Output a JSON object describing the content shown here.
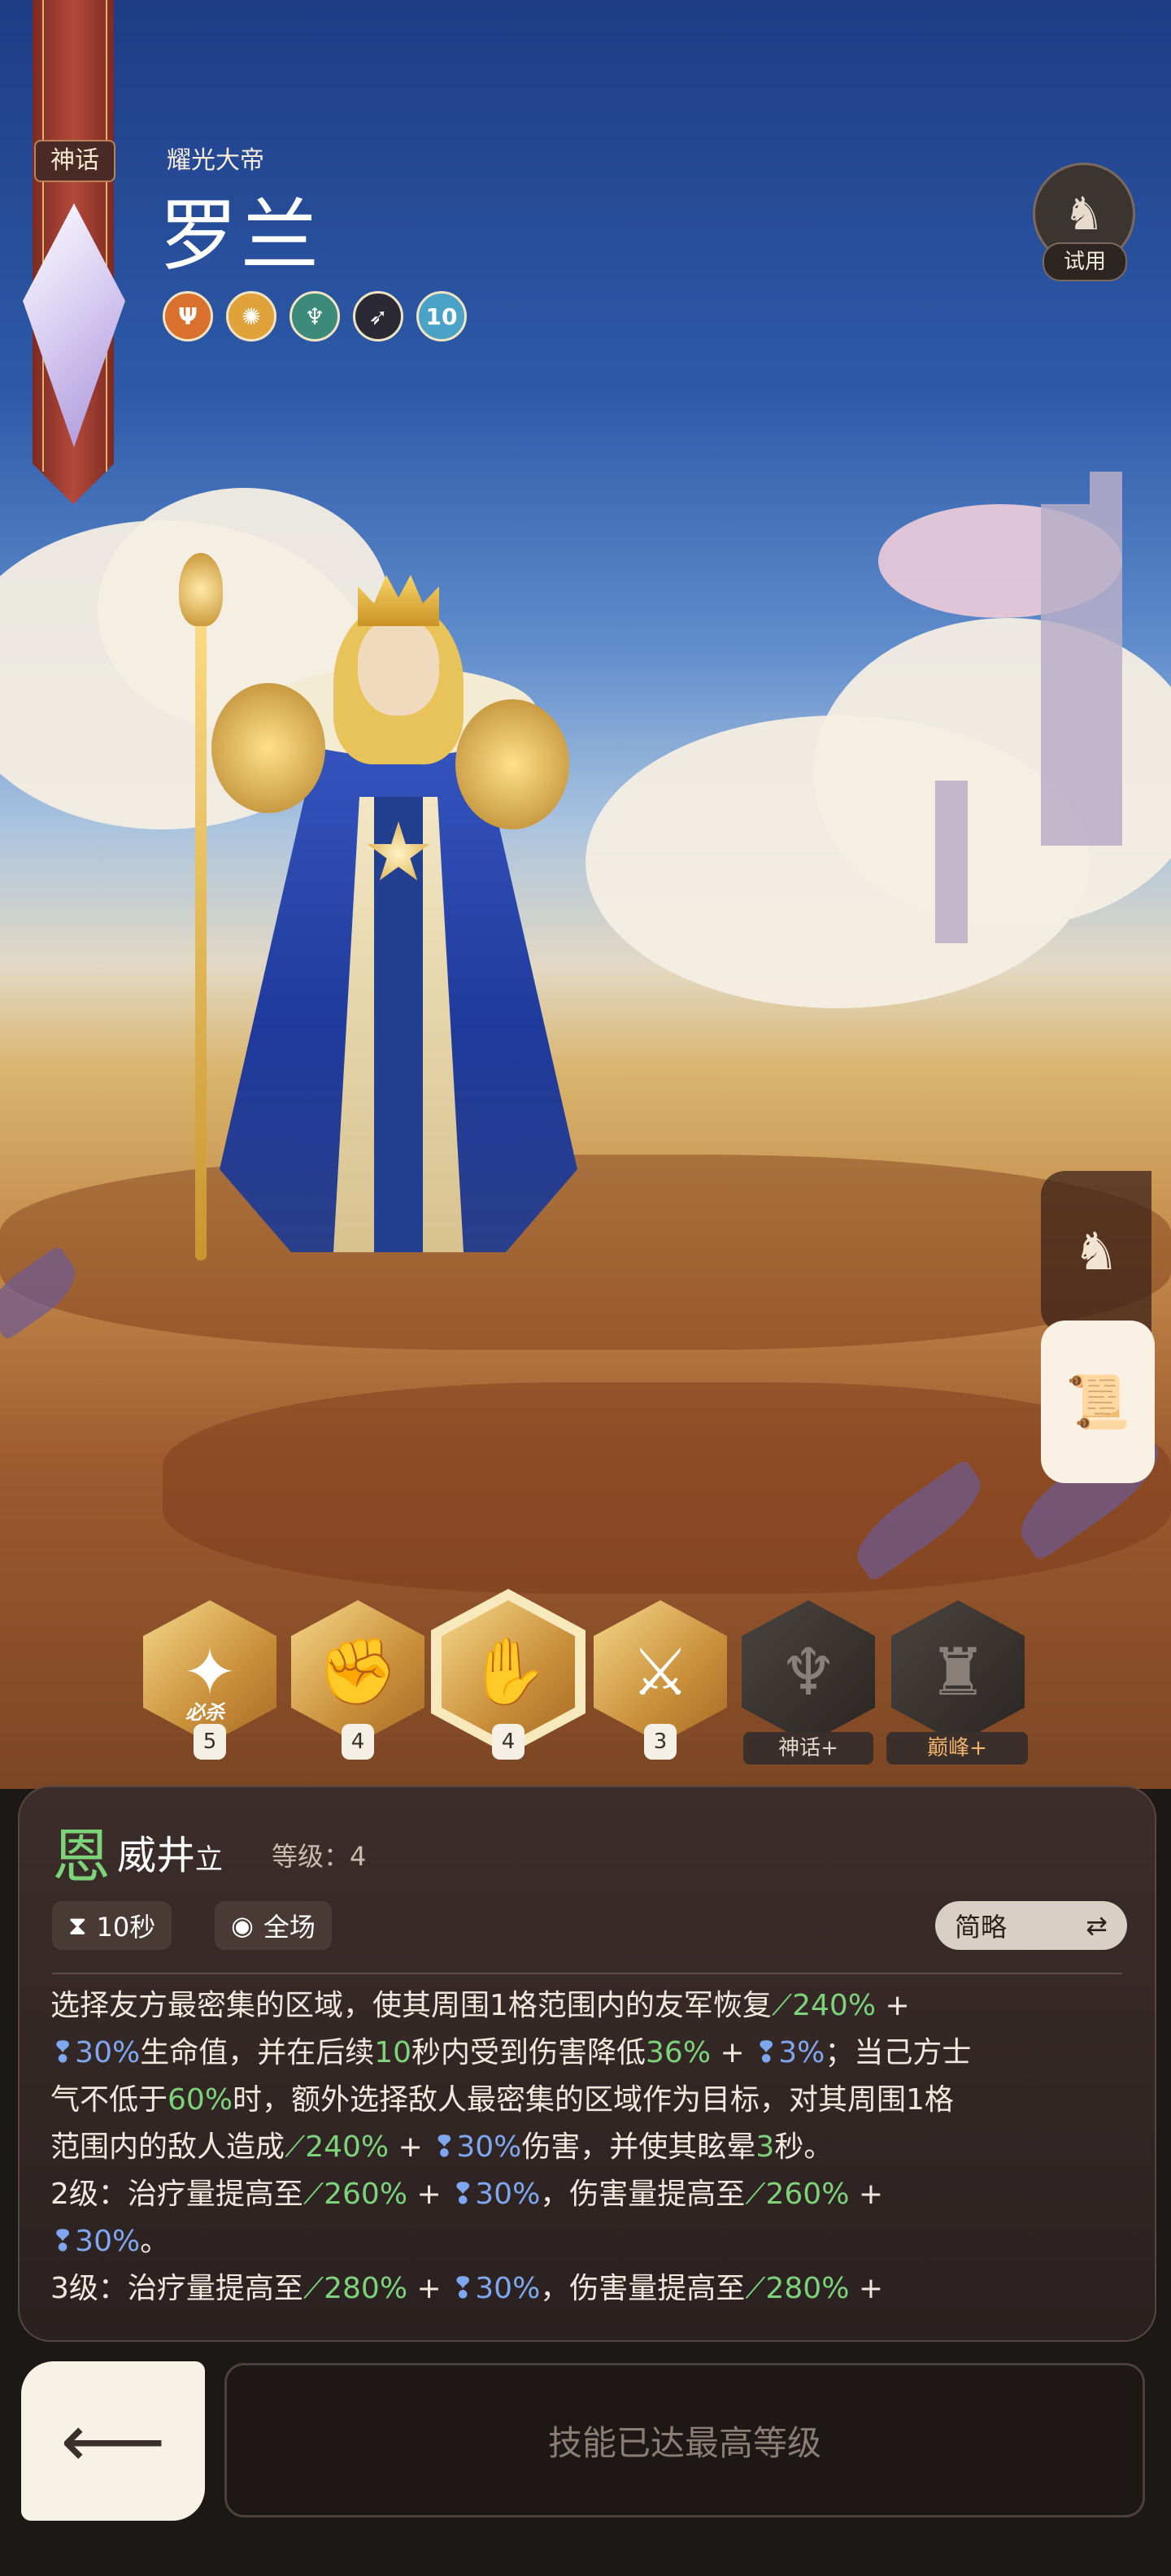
{
  "hero": {
    "rarity": "神话",
    "subtitle": "耀光大帝",
    "name": "罗兰",
    "traits": [
      {
        "icon": "trident-icon",
        "color": "#d9702e"
      },
      {
        "icon": "sun-icon",
        "color": "#e0a23a"
      },
      {
        "icon": "trident-ring-icon",
        "color": "#3c8a7a"
      },
      {
        "icon": "feather-icon",
        "color": "#2b2a34"
      },
      {
        "icon": "level-badge-icon",
        "color": "#4aa3c7",
        "text": "10"
      }
    ],
    "trial_label": "试用"
  },
  "side_tabs": [
    {
      "icon": "helmet-icon",
      "active": false
    },
    {
      "icon": "scroll-icon",
      "active": true
    }
  ],
  "skills": [
    {
      "icon": "sword-burst-icon",
      "level": "5",
      "tag": "必杀",
      "state": "gold"
    },
    {
      "icon": "fist-icon",
      "level": "4",
      "state": "gold"
    },
    {
      "icon": "shield-hand-icon",
      "level": "4",
      "state": "selected"
    },
    {
      "icon": "sword-strike-icon",
      "level": "3",
      "state": "gold"
    },
    {
      "icon": "trident-dark-icon",
      "lock_label": "神话+",
      "state": "locked"
    },
    {
      "icon": "armor-dark-icon",
      "lock_label": "巅峰+",
      "state": "locked"
    }
  ],
  "panel": {
    "skill_glyph": "恩",
    "skill_name": "威井",
    "skill_name_suffix": "立",
    "level_label": "等级：4",
    "cooldown": "10秒",
    "range": "全场",
    "mode_button": "简略",
    "description": {
      "l1": [
        "选择友方最密集的区域，使其周围1格范围内的友军恢复",
        "240%",
        " + "
      ],
      "l2": [
        "30%",
        "生命值，并在后续",
        "10",
        "秒内受到伤害降低",
        "36%",
        " + ",
        "3%",
        "；当己方士"
      ],
      "l3": [
        "气不低于",
        "60%",
        "时，额外选择敌人最密集的区域作为目标，对其周围1格"
      ],
      "l4": [
        "范围内的敌人造成",
        "240%",
        " + ",
        "30%",
        "伤害，并使其眩晕",
        "3",
        "秒。"
      ],
      "l5": [
        "2级：治疗量提高至",
        "260%",
        " + ",
        "30%",
        "，伤害量提高至",
        "260%",
        " +"
      ],
      "l6": [
        "30%",
        "。"
      ],
      "l7": [
        "3级：治疗量提高至",
        "280%",
        " + ",
        "30%",
        "，伤害量提高至",
        "280%",
        " +"
      ]
    }
  },
  "bottom": {
    "back_icon": "arrow-left-icon",
    "maxed_label": "技能已达最高等级"
  }
}
